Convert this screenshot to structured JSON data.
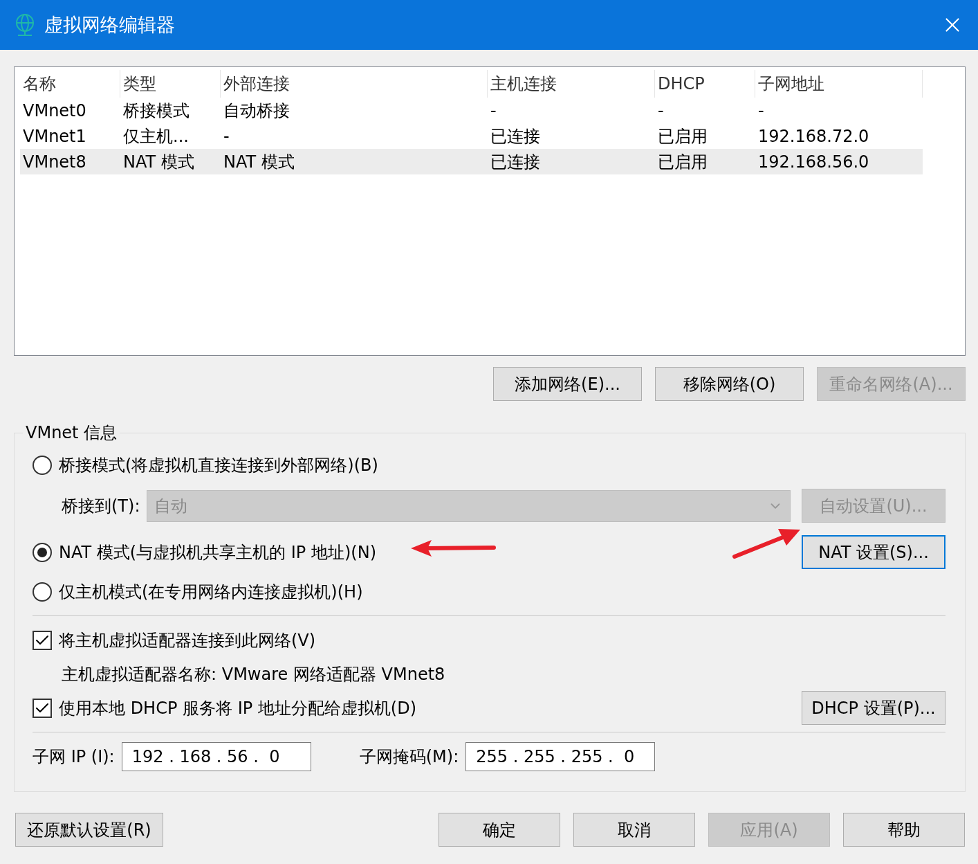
{
  "window": {
    "title": "虚拟网络编辑器"
  },
  "table": {
    "columns": [
      "名称",
      "类型",
      "外部连接",
      "主机连接",
      "DHCP",
      "子网地址"
    ],
    "rows": [
      {
        "cells": [
          "VMnet0",
          "桥接模式",
          "自动桥接",
          "-",
          "-",
          "-"
        ],
        "selected": false
      },
      {
        "cells": [
          "VMnet1",
          "仅主机...",
          "-",
          "已连接",
          "已启用",
          "192.168.72.0"
        ],
        "selected": false
      },
      {
        "cells": [
          "VMnet8",
          "NAT 模式",
          "NAT 模式",
          "已连接",
          "已启用",
          "192.168.56.0"
        ],
        "selected": true
      }
    ]
  },
  "network_buttons": [
    {
      "label": "添加网络(E)...",
      "disabled": false
    },
    {
      "label": "移除网络(O)",
      "disabled": false
    },
    {
      "label": "重命名网络(A)...",
      "disabled": true
    }
  ],
  "vmnet_info": {
    "title": "VMnet 信息",
    "modes": [
      {
        "kind": "bridge",
        "label": "桥接模式(将虚拟机直接连接到外部网络)(B)",
        "selected": false
      },
      {
        "kind": "nat",
        "label": "NAT 模式(与虚拟机共享主机的 IP 地址)(N)",
        "selected": true
      },
      {
        "kind": "host",
        "label": "仅主机模式(在专用网络内连接虚拟机)(H)",
        "selected": false
      }
    ],
    "bridge_to": {
      "label": "桥接到(T):",
      "value": "自动",
      "disabled": true,
      "button": {
        "label": "自动设置(U)...",
        "disabled": true
      }
    },
    "nat_button": {
      "label": "NAT 设置(S)...",
      "focused": true
    },
    "connect_adapter": {
      "label": "将主机虚拟适配器连接到此网络(V)",
      "checked": true
    },
    "adapter_name": "主机虚拟适配器名称: VMware 网络适配器 VMnet8",
    "use_dhcp": {
      "label": "使用本地 DHCP 服务将 IP 地址分配给虚拟机(D)",
      "checked": true
    },
    "dhcp_button": {
      "label": "DHCP 设置(P)..."
    },
    "subnet_ip": {
      "label": "子网 IP (I):",
      "value": "192 . 168 . 56 .  0"
    },
    "subnet_mask": {
      "label": "子网掩码(M):",
      "value": "255 . 255 . 255 .  0"
    }
  },
  "footer_buttons": [
    {
      "label": "还原默认设置(R)",
      "disabled": false
    },
    {
      "label": "确定",
      "disabled": false
    },
    {
      "label": "取消",
      "disabled": false
    },
    {
      "label": "应用(A)",
      "disabled": true
    },
    {
      "label": "帮助",
      "disabled": false
    }
  ]
}
